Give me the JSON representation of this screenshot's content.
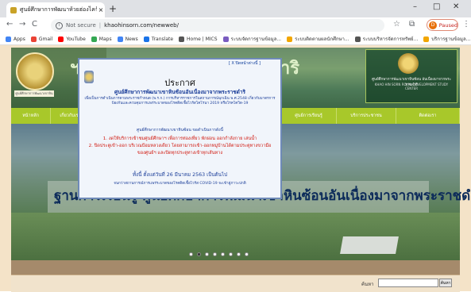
{
  "browser": {
    "tab_title": "ศูนย์ศึกษาการพัฒนาห้วยฮ่องไคร้ฯ",
    "tab_close": "×",
    "new_tab": "+",
    "window_controls": [
      "–",
      "□",
      "✕"
    ],
    "nav": {
      "back": "←",
      "forward": "→",
      "reload": "C"
    },
    "security_label": "Not secure",
    "url": "khaohinsorn.com/newweb/",
    "toolbar_icons": {
      "star": "☆",
      "extensions": "⧉",
      "menu": "⋮"
    },
    "profile_initial": "D",
    "profile_status": "Paused"
  },
  "bookmarks": [
    {
      "label": "Apps",
      "color": "#4285f4"
    },
    {
      "label": "Gmail",
      "color": "#ea4335"
    },
    {
      "label": "YouTube",
      "color": "#ff0000"
    },
    {
      "label": "Maps",
      "color": "#34a853"
    },
    {
      "label": "News",
      "color": "#4285f4"
    },
    {
      "label": "Translate",
      "color": "#1a73e8"
    },
    {
      "label": "Home | MICS",
      "color": "#555555"
    },
    {
      "label": "ระบบจัดการฐานข้อมูล...",
      "color": "#7a5cc0"
    },
    {
      "label": "ระบบติดตามผลนักศึกษา...",
      "color": "#f2a600"
    },
    {
      "label": "ระบบบริหารจัดการทรัพย์...",
      "color": "#555555"
    },
    {
      "label": "บริการฐานข้อมูล...",
      "color": "#f2a600"
    }
  ],
  "header": {
    "title_partial": "ฯ",
    "title_partial_right": "ยำริ",
    "subtitle_partial": "ter",
    "logo_right_line1": "ศูนย์ศึกษาการพัฒนาเขาหินซ้อน อันเนื่องมาจากพระราชดำริ",
    "logo_right_line2": "KHAO HIN SORN ROYAL DEVELOPMENT STUDY CENTER",
    "seal_caption": "ศูนย์ศึกษาการพัฒนาเขาหินซ้อน"
  },
  "menu": [
    "หน้าหลัก",
    "เกี่ยวกับเรา",
    "",
    "",
    "",
    "",
    "",
    "ศูนย์การเรียนรู้",
    "บริการประชาชน",
    "ติดต่อเรา"
  ],
  "slider": {
    "text": "ฐานการเรียนรู้ ศูนย์ศึกษาการพัฒนาเขาหินซ้อนอันเนื่องมาจากพระราชดำริ",
    "dot_count": 8,
    "active_dot": 1
  },
  "popup": {
    "close_label": "[ X ปิดหน้าต่างนี้ ]",
    "title": "ประกาศ",
    "org": "ศูนย์ศึกษาการพัฒนาเขาหินซ้อนอันเนื่องมาจากพระราชดำริ",
    "body": "เพื่อเป็นการดำเนินการตามพระราชกำหนด (พ.ร.ก.) การบริหารราชการในสถานการณ์ฉุกเฉิน พ.ศ.2548 เกี่ยวกับมาตรการป้องกันและควบคุมการแพร่ระบาดของโรคติดเชื้อไวรัสโคโรนา 2019 หรือโรคโควิด-19",
    "lead": "ศูนย์ศึกษาการพัฒนาเขาหินซ้อน ขอดำเนินการดังนี้",
    "item1": "1. งดให้บริการเข้าชมศูนย์ศึกษาฯ เพื่อการท่องเที่ยว พักผ่อน ออกกำลังกาย เล่นน้ำ",
    "item2": "2. ปิดประตูเข้า-ออก บริเวณป้อมหลวงเดียว โดยสามารถเข้า-ออกหมู่บ้านได้ตามประตูทางขวามือ ของศูนย์ฯ และปิดทุกประตูทางเข้าทุกเส้นทาง",
    "date": "ทั้งนี้ ตั้งแต่วันที่ 26 มีนาคม 2563 เป็นต้นไป",
    "footer": "จนกว่าสถานการณ์การแพร่ระบาดของโรคติดเชื้อไวรัส COVID-19 จะเข้าสู่ภาวะปกติ"
  },
  "search": {
    "label": "ค้นหา",
    "placeholder": "",
    "button": "ค้นหา"
  },
  "colors": {
    "menu_green": "#a8c82a",
    "page_bg": "#f4e3c8",
    "popup_blue": "#1c3f9a",
    "popup_red": "#d1190f"
  }
}
